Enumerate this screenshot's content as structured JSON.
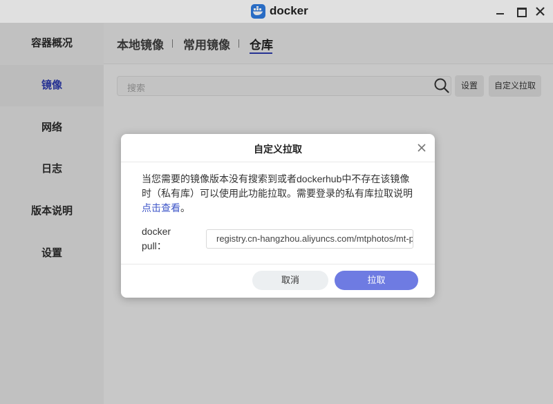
{
  "app": {
    "title": "docker",
    "logo_color": "#2f7be0",
    "accent_color": "#2c3aa8"
  },
  "sidebar": {
    "items": [
      {
        "label": "容器概况",
        "active": false
      },
      {
        "label": "镜像",
        "active": true
      },
      {
        "label": "网络",
        "active": false
      },
      {
        "label": "日志",
        "active": false
      },
      {
        "label": "版本说明",
        "active": false
      },
      {
        "label": "设置",
        "active": false
      }
    ]
  },
  "tabs": [
    {
      "label": "本地镜像",
      "active": false
    },
    {
      "label": "常用镜像",
      "active": false
    },
    {
      "label": "仓库",
      "active": true
    }
  ],
  "search": {
    "placeholder": "搜索",
    "icon": "search-icon"
  },
  "toolbar": {
    "settings_label": "设置",
    "custom_pull_label": "自定义拉取"
  },
  "dialog": {
    "title": "自定义拉取",
    "description": "当您需要的镜像版本没有搜索到或者dockerhub中不存在该镜像时（私有库）可以使用此功能拉取。需要登录的私有库拉取说明",
    "link_text": "点击查看",
    "description_end": "。",
    "field_label": "docker pull：",
    "field_value": "registry.cn-hangzhou.aliyuncs.com/mtphotos/mt-photos",
    "cancel_label": "取消",
    "confirm_label": "拉取",
    "confirm_color": "#6e7be2"
  }
}
